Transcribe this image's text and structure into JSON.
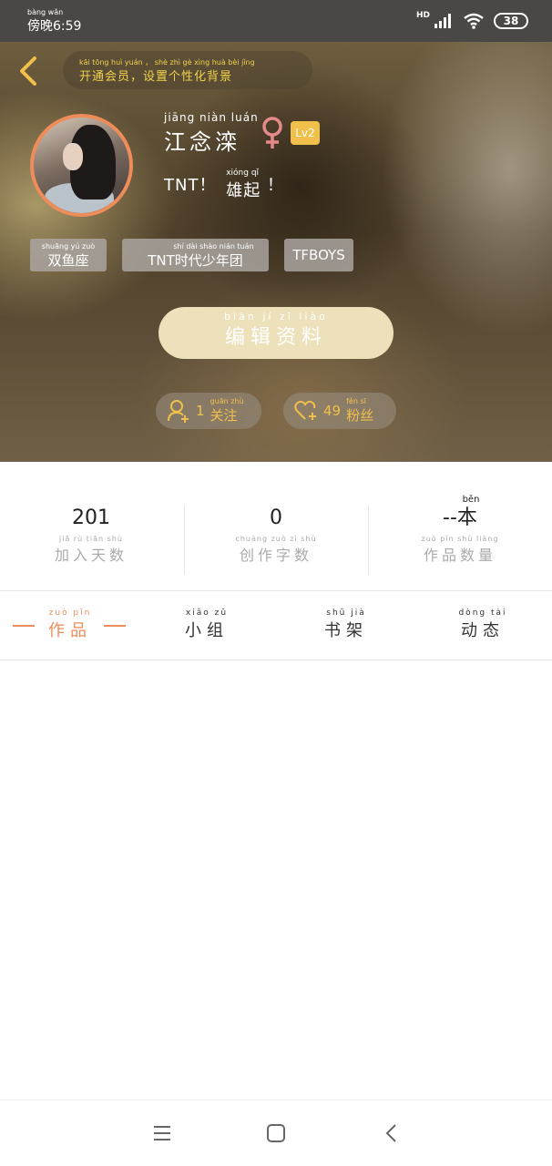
{
  "status_bar": {
    "time_pinyin": "bàng wǎn",
    "time": "傍晚6:59",
    "network": "HD",
    "battery": "38"
  },
  "header": {
    "vip_pinyin": "kāi tōng huì yuán ， shè zhì gè xìng huà bèi jǐng",
    "vip_label": "开通会员，设置个性化背景"
  },
  "profile": {
    "name_pinyin": "jiāng niàn luán",
    "name": "江念滦",
    "level": "Lv2",
    "motto_prefix": "TNT！",
    "motto_pinyin": "xióng qǐ",
    "motto_word": "雄起",
    "motto_suffix": "！",
    "tags": [
      {
        "pinyin": "shuāng yú zuò",
        "label": "双鱼座"
      },
      {
        "pinyin": "shí dài shào nián tuán",
        "label": "TNT时代少年团"
      },
      {
        "pinyin": "",
        "label": "TFBOYS"
      }
    ],
    "edit_pinyin": "biān jí zī liào",
    "edit_label": "编辑资料",
    "following_count": "1",
    "following_pinyin": "guān zhù",
    "following_label": "关注",
    "fans_count": "49",
    "fans_pinyin": "fěn sī",
    "fans_label": "粉丝"
  },
  "stats": [
    {
      "value": "201",
      "value_pinyin": "",
      "caption_pinyin": "jiā rù tiān shù",
      "caption": "加入天数"
    },
    {
      "value": "0",
      "value_pinyin": "",
      "caption_pinyin": "chuàng zuò zì shù",
      "caption": "创作字数"
    },
    {
      "value": "--本",
      "value_pinyin": "běn",
      "caption_pinyin": "zuò pǐn shù liàng",
      "caption": "作品数量"
    }
  ],
  "tabs": [
    {
      "pinyin": "zuò pǐn",
      "label": "作品"
    },
    {
      "pinyin": "xiǎo zǔ",
      "label": "小组"
    },
    {
      "pinyin": "shū jià",
      "label": "书架"
    },
    {
      "pinyin": "dòng tài",
      "label": "动态"
    }
  ],
  "colors": {
    "accent": "#ee8c5a",
    "gold": "#f1c04b",
    "edit_button": "#ece1bb",
    "gender": "#e58a8a"
  },
  "icons": {
    "back": "chevron-left-icon",
    "gender": "female-icon",
    "follow": "add-user-icon",
    "fans": "heart-plus-icon",
    "nav_menu": "menu-icon",
    "nav_home": "square-icon",
    "nav_back": "back-triangle-icon"
  }
}
